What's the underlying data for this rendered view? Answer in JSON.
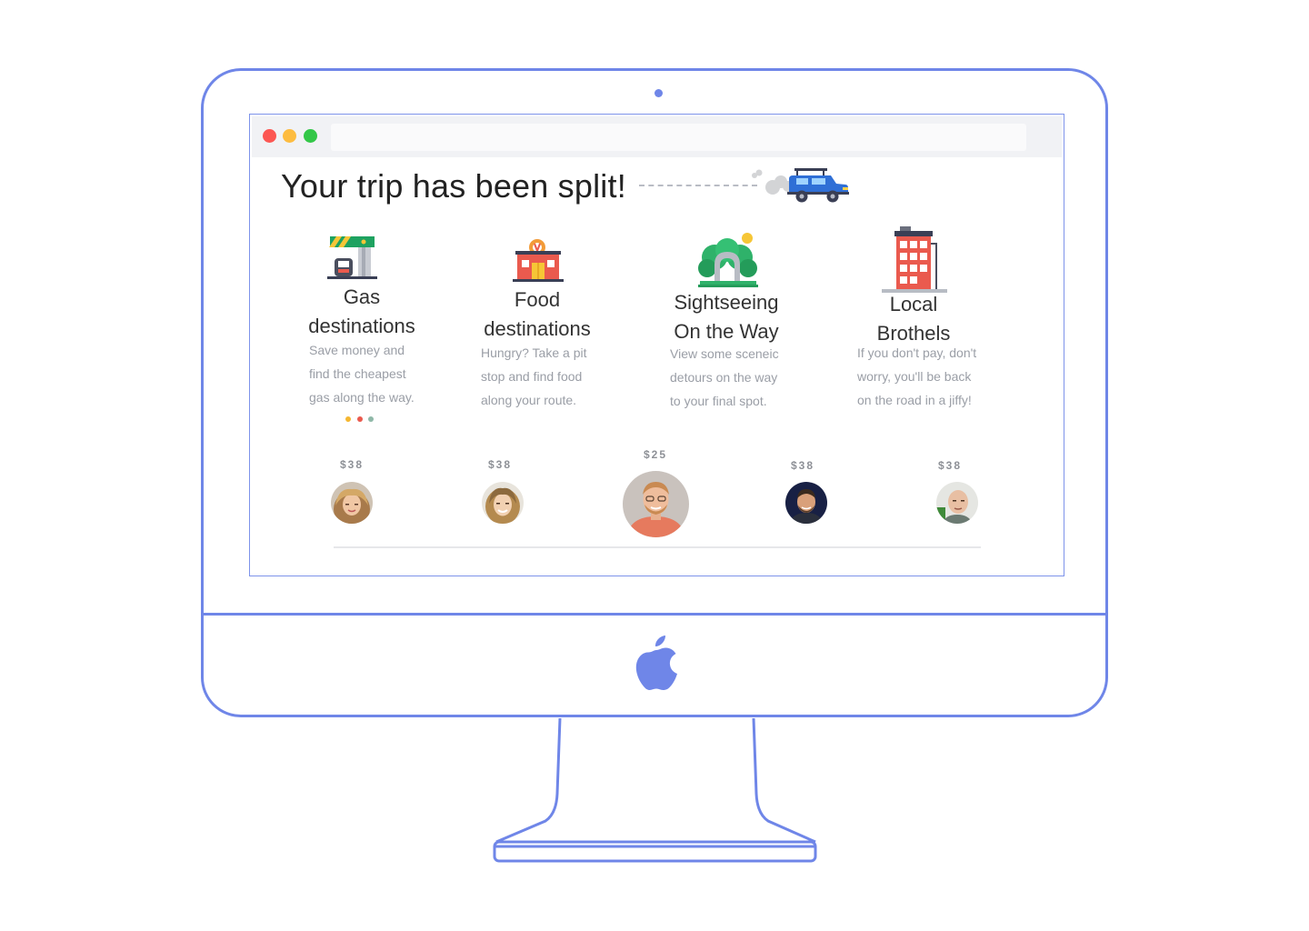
{
  "page": {
    "headline": "Your trip has been split!"
  },
  "categories": [
    {
      "title_line1": "Gas",
      "title_line2": "destinations",
      "desc": [
        "Save money and",
        "find the cheapest",
        "gas along the way."
      ],
      "icon": "gas-station-icon"
    },
    {
      "title_line1": "Food",
      "title_line2": "destinations",
      "desc": [
        "Hungry? Take a pit",
        "stop and find food",
        "along your route."
      ],
      "icon": "restaurant-icon"
    },
    {
      "title_line1": "Sightseeing",
      "title_line2": "On the Way",
      "desc": [
        "View some sceneic",
        "detours on the way",
        "to your final spot."
      ],
      "icon": "park-arch-icon"
    },
    {
      "title_line1": "Local",
      "title_line2": "Brothels",
      "desc": [
        "If you don't pay, don't",
        "worry, you'll be back",
        "on the road in a jiffy!"
      ],
      "icon": "apartment-building-icon"
    }
  ],
  "pagination_dots": [
    "#f5b731",
    "#ea5a4e",
    "#8fb8a8"
  ],
  "riders": [
    {
      "price": "$38",
      "icon": "avatar-woman-1"
    },
    {
      "price": "$38",
      "icon": "avatar-woman-2"
    },
    {
      "price": "$25",
      "icon": "avatar-man-orange-shirt"
    },
    {
      "price": "$38",
      "icon": "avatar-man-dark"
    },
    {
      "price": "$38",
      "icon": "avatar-man-bald"
    }
  ],
  "colors": {
    "accent": "#6f86e8",
    "traffic_red": "#fc5753",
    "traffic_yellow": "#fdbc40",
    "traffic_green": "#33c748"
  }
}
